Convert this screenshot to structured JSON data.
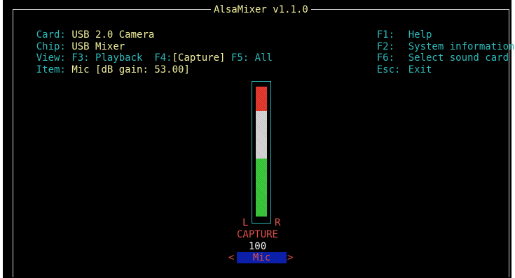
{
  "app": {
    "title": "AlsaMixer v1.1.0"
  },
  "info": {
    "card_label": "Card:",
    "card_value": "USB 2.0 Camera",
    "chip_label": "Chip:",
    "chip_value": "USB Mixer",
    "view_label": "View:",
    "view_playback": "F3: Playback",
    "view_capture_key": "F4:",
    "view_capture": "[Capture]",
    "view_all": "F5: All",
    "item_label": "Item:",
    "item_value": "Mic [dB gain: 53.00]"
  },
  "shortcuts": [
    {
      "key": "F1:",
      "action": "Help"
    },
    {
      "key": "F2:",
      "action": "System information"
    },
    {
      "key": "F6:",
      "action": "Select sound card"
    },
    {
      "key": "Esc:",
      "action": "Exit"
    }
  ],
  "control": {
    "left_label": "L",
    "right_label": "R",
    "mode_label": "CAPTURE",
    "volume": "100",
    "name": "Mic",
    "prev_arrow": "<",
    "next_arrow": ">",
    "level_fraction": 1.0
  },
  "colors": {
    "background": "#000000",
    "label": "#2fb8b8",
    "value": "#f0ee9c",
    "meter_red": "#d6281e",
    "meter_white": "#dcdcdc",
    "meter_green": "#27b52a",
    "selected_bg": "#0c1fa8"
  }
}
